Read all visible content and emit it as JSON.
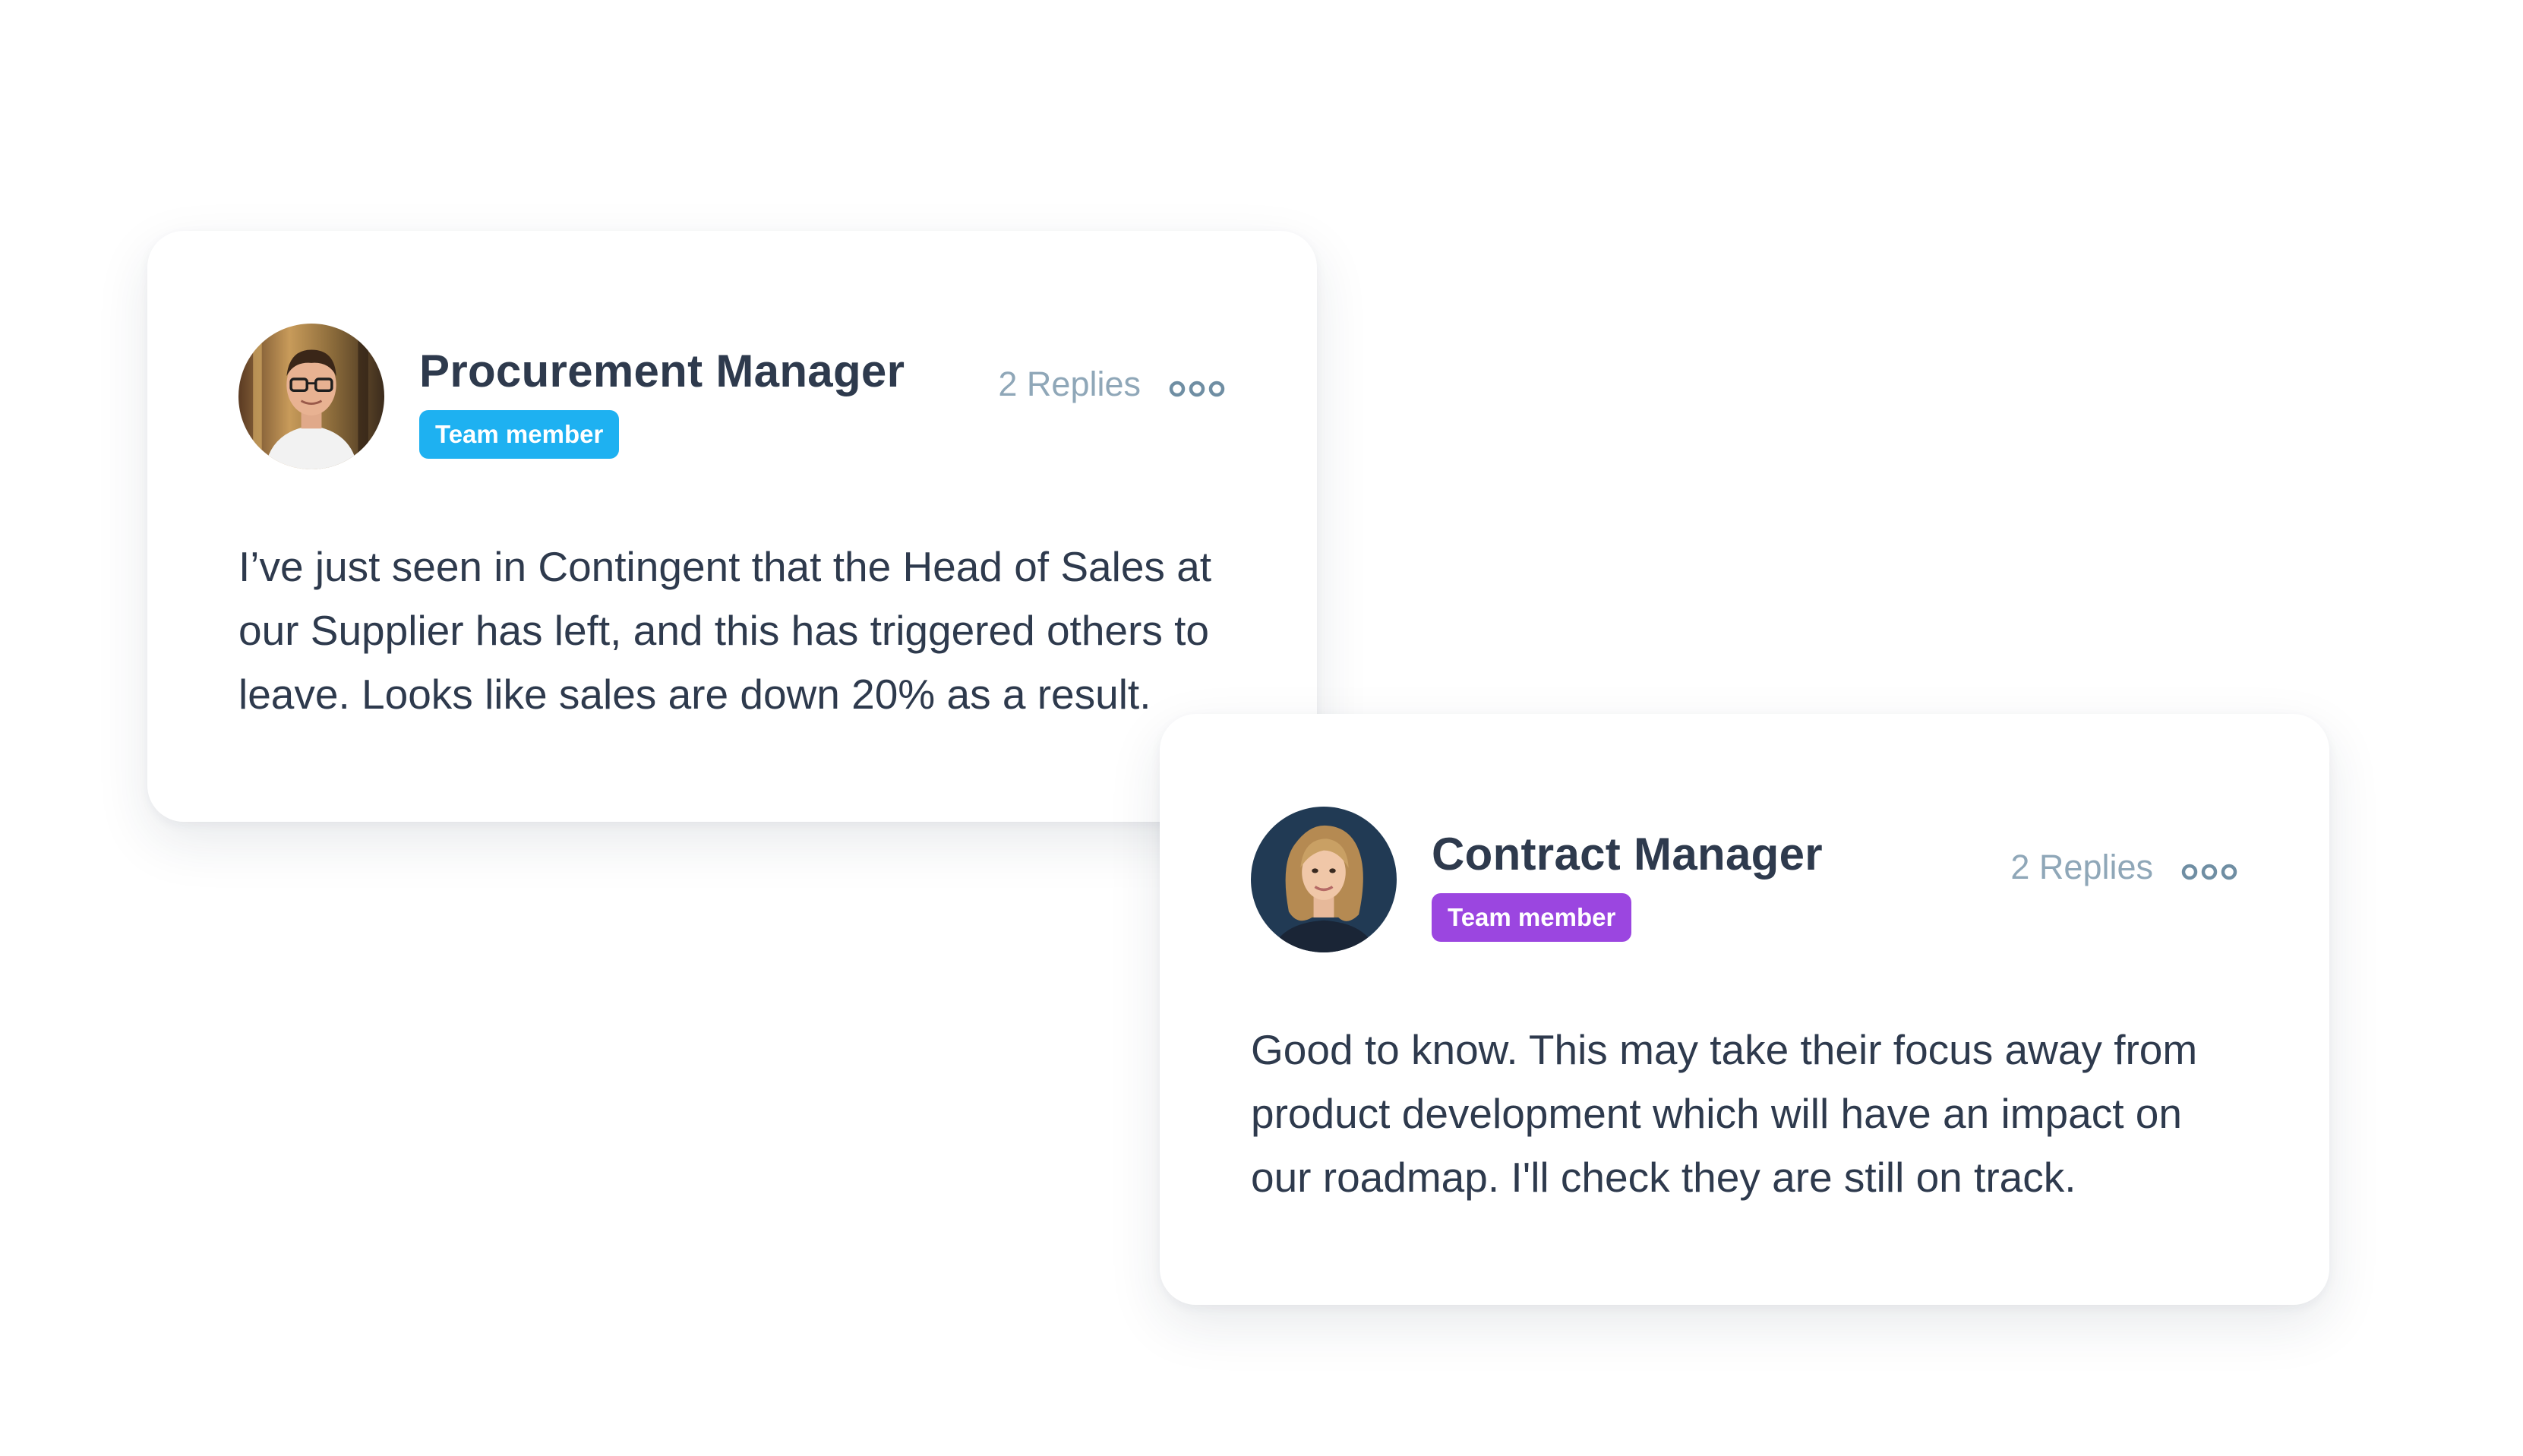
{
  "theme": {
    "text_color": "#2e3a4d",
    "muted_color": "#8fa7b8",
    "badge_blue": "#1eb1f1",
    "badge_purple": "#9b46e0"
  },
  "comments": [
    {
      "author": "Procurement Manager",
      "badge": "Team member",
      "badge_color": "#1eb1f1",
      "replies": "2 Replies",
      "menu_icon": "more-dots-icon",
      "avatar_icon": "man-with-glasses-avatar",
      "text": "I’ve just seen in Contingent that the Head of Sales at our Supplier has left, and this has triggered others to leave. Looks like sales are down 20% as a result."
    },
    {
      "author": "Contract Manager",
      "badge": "Team member",
      "badge_color": "#9b46e0",
      "replies": "2 Replies",
      "menu_icon": "more-dots-icon",
      "avatar_icon": "woman-blonde-avatar",
      "text": "Good to know. This may take their focus away from product development which will have an impact on our roadmap. I'll check they are still on track."
    }
  ]
}
